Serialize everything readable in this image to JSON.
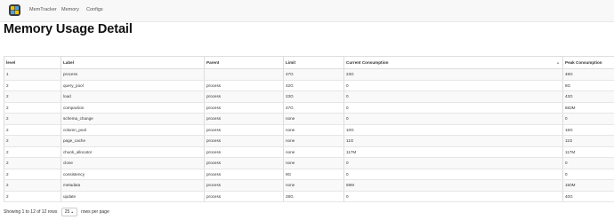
{
  "nav": {
    "brand": "MemTracker",
    "links": [
      "Memory",
      "Configs"
    ]
  },
  "page": {
    "title": "Memory Usage Detail"
  },
  "table": {
    "columns": [
      "level",
      "Label",
      "Parent",
      "Limit",
      "Current Consumption",
      "Peak Consumption"
    ],
    "rows": [
      [
        "1",
        "process",
        "",
        "47G",
        "23G",
        "48G"
      ],
      [
        "2",
        "query_pool",
        "process",
        "42G",
        "0",
        "8G"
      ],
      [
        "2",
        "load",
        "process",
        "23G",
        "0",
        "43G"
      ],
      [
        "2",
        "compaction",
        "process",
        "47G",
        "0",
        "683M"
      ],
      [
        "2",
        "schema_change",
        "process",
        "none",
        "0",
        "0"
      ],
      [
        "2",
        "column_pool",
        "process",
        "none",
        "10G",
        "16G"
      ],
      [
        "2",
        "page_cache",
        "process",
        "none",
        "11G",
        "11G"
      ],
      [
        "2",
        "chunk_allocator",
        "process",
        "none",
        "117M",
        "117M"
      ],
      [
        "2",
        "clone",
        "process",
        "none",
        "0",
        "0"
      ],
      [
        "2",
        "consistency",
        "process",
        "9G",
        "0",
        "0"
      ],
      [
        "2",
        "metadata",
        "process",
        "none",
        "59M",
        "150M"
      ],
      [
        "2",
        "update",
        "process",
        "28G",
        "0",
        "40G"
      ]
    ]
  },
  "footer": {
    "showing": "Showing 1 to 12 of 12 rows",
    "page_size": "25",
    "page_size_caret": "▲",
    "per_page": "rows per page"
  },
  "icons": {
    "sort": "sort-icon",
    "logo": "app-logo-icon"
  }
}
